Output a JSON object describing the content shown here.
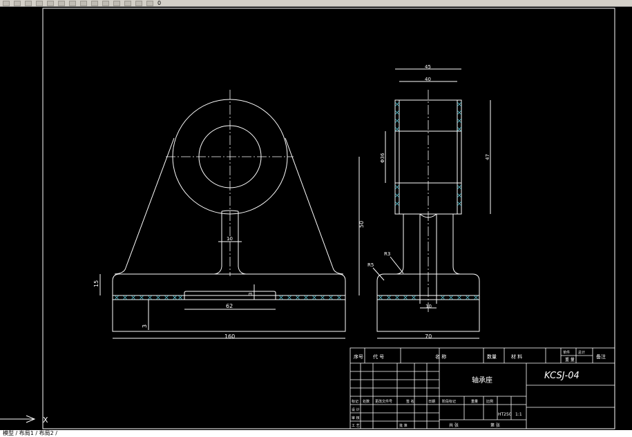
{
  "toolbar": {
    "layer_label": "0",
    "extra_label": "",
    "buttons": [
      "new",
      "open",
      "save",
      "print",
      "preview",
      "cut",
      "copy",
      "paste",
      "undo",
      "redo",
      "pan",
      "zoom",
      "properties",
      "layers"
    ]
  },
  "command_line": {
    "text": "模型 / 布局1 / 布局2 /"
  },
  "drawing": {
    "front_view": {
      "dims": {
        "width_160": "160",
        "height_50": "50",
        "height_15": "15",
        "base_3": "3",
        "slot_62": "62",
        "slot_3": "3",
        "web_10": "10"
      }
    },
    "side_view": {
      "dims": {
        "width_45": "45",
        "width_40": "40",
        "dia_36": "Φ36",
        "height_47": "47",
        "r3": "R3",
        "r5": "R5",
        "rib_10": "10",
        "base_70": "70"
      }
    },
    "title_block": {
      "header": {
        "seq": "序号",
        "code": "代  号",
        "name": "名  称",
        "qty": "数量",
        "material": "材  料",
        "single": "单件",
        "total": "总计",
        "weight": "重  量",
        "remark": "备注"
      },
      "part_name": "轴承座",
      "drawing_code": "KCSJ-04",
      "material_value": "HT250",
      "scale_value": "1:1",
      "rows_left": [
        "标记",
        "处数",
        "更改文件号",
        "签 名",
        "日期"
      ],
      "roles": [
        "设 计",
        "审 核",
        "工 艺",
        "批 准"
      ],
      "stage_label": "阶段标记",
      "weight_label": "重量",
      "scale_label": "比例",
      "sheet_total": "共  张",
      "sheet_no": "第  张"
    },
    "ucs": {
      "x_label": "X"
    }
  }
}
